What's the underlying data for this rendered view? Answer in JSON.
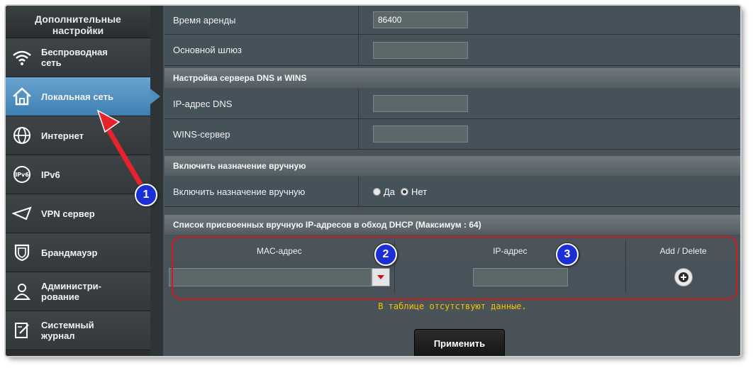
{
  "sidebar": {
    "header": "Дополнительные настройки",
    "items": [
      {
        "label": "Беспроводная сеть",
        "icon": "wifi-icon"
      },
      {
        "label": "Локальная сеть",
        "icon": "home-icon"
      },
      {
        "label": "Интернет",
        "icon": "globe-icon"
      },
      {
        "label": "IPv6",
        "icon": "ipv6-icon"
      },
      {
        "label": "VPN сервер",
        "icon": "vpn-icon"
      },
      {
        "label": "Брандмауэр",
        "icon": "shield-icon"
      },
      {
        "label": "Администри-рование",
        "icon": "admin-user-icon"
      },
      {
        "label": "Системный журнал",
        "icon": "log-icon"
      }
    ]
  },
  "dhcp": {
    "lease_label": "Время аренды",
    "lease_value": "86400",
    "gateway_label": "Основной шлюз",
    "gateway_value": ""
  },
  "dns_section": {
    "title": "Настройка сервера DNS и WINS",
    "dns_label": "IP-адрес DNS",
    "dns_value": "",
    "wins_label": "WINS-сервер",
    "wins_value": ""
  },
  "manual_section": {
    "title": "Включить назначение вручную",
    "row_label": "Включить назначение вручную",
    "option_yes": "Да",
    "option_no": "Нет",
    "selected": "Нет"
  },
  "assigned_list": {
    "title": "Список присвоенных вручную IP-адресов в обход DHCP (Максимум : 64)",
    "col_mac": "MAC-адрес",
    "col_ip": "IP-адрес",
    "col_action": "Add / Delete",
    "empty_text": "В таблице отсутствуют данные."
  },
  "apply_label": "Применить",
  "badges": [
    "1",
    "2",
    "3"
  ],
  "colors": {
    "accent": "#3d7fb2",
    "annotation_red": "#c81e1e",
    "badge_blue": "#1a2fd6",
    "nodata_yellow": "#f2c200"
  }
}
